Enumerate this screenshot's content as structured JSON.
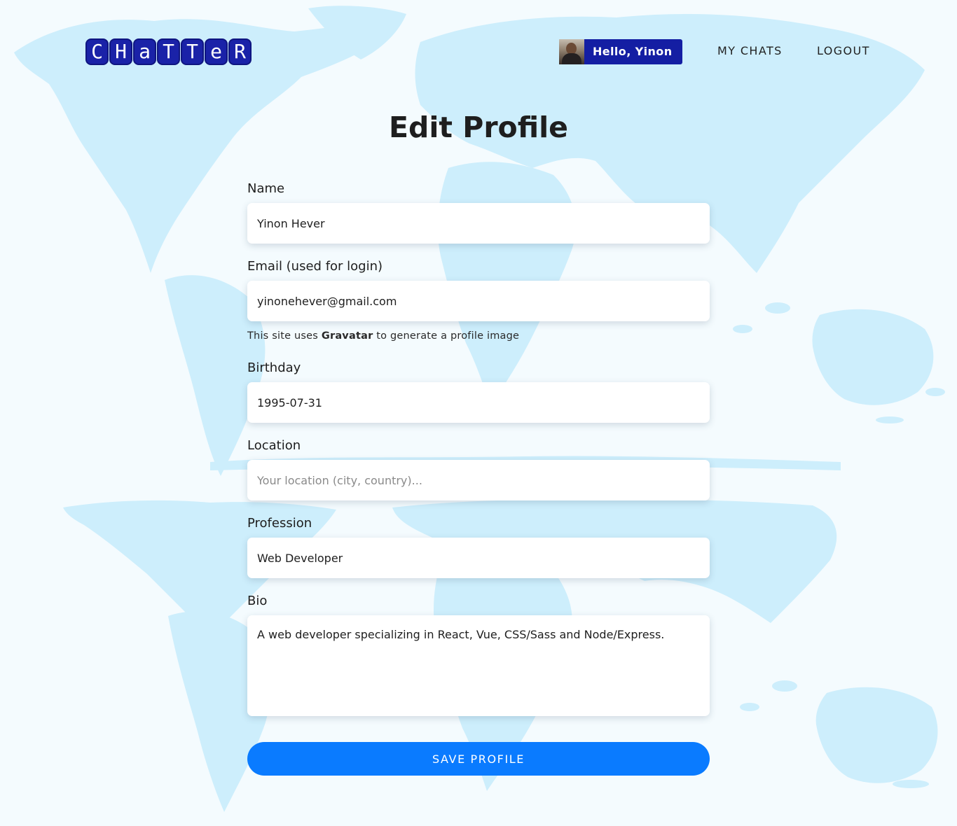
{
  "brand": {
    "logo_letters": [
      "C",
      "H",
      "a",
      "T",
      "T",
      "e",
      "R"
    ]
  },
  "header": {
    "greeting": "Hello, Yinon",
    "nav": {
      "my_chats": "MY CHATS",
      "logout": "LOGOUT"
    }
  },
  "page": {
    "title": "Edit Profile"
  },
  "form": {
    "name": {
      "label": "Name",
      "value": "Yinon Hever"
    },
    "email": {
      "label": "Email (used for login)",
      "value": "yinonehever@gmail.com",
      "hint_prefix": "This site uses ",
      "hint_link": "Gravatar",
      "hint_suffix": " to generate a profile image"
    },
    "birthday": {
      "label": "Birthday",
      "value": "1995-07-31"
    },
    "location": {
      "label": "Location",
      "value": "",
      "placeholder": "Your location (city, country)..."
    },
    "profession": {
      "label": "Profession",
      "value": "Web Developer"
    },
    "bio": {
      "label": "Bio",
      "value": "A web developer specializing in React, Vue, CSS/Sass and Node/Express."
    },
    "save_label": "SAVE PROFILE"
  },
  "colors": {
    "brand_navy": "#141ea3",
    "primary_button": "#0a7bff",
    "map_fill": "#cdeefc",
    "page_background": "#f4fbfe"
  }
}
